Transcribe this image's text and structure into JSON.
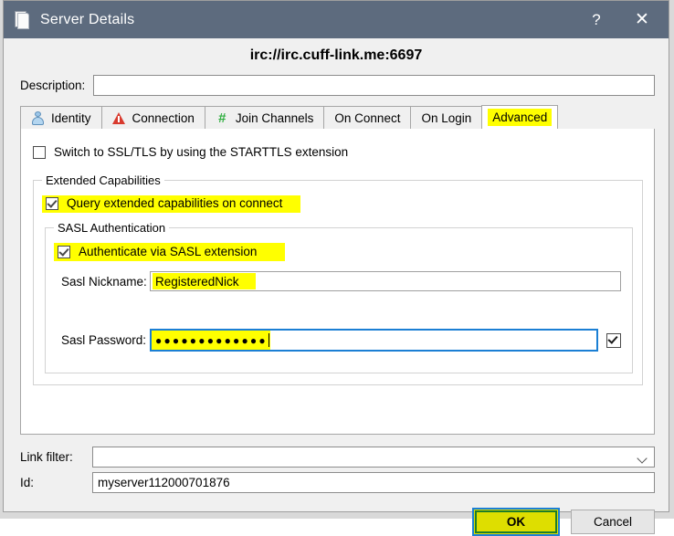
{
  "window": {
    "title": "Server Details",
    "icon": "page-icon",
    "help_label": "?",
    "close_label": "✕"
  },
  "header": {
    "server_url": "irc://irc.cuff-link.me:6697"
  },
  "description": {
    "label": "Description:",
    "value": "",
    "placeholder": ""
  },
  "tabs": [
    {
      "label": "Identity",
      "icon": "person-icon",
      "selected": false,
      "highlighted": false
    },
    {
      "label": "Connection",
      "icon": "warning-triangle-icon",
      "selected": false,
      "highlighted": false
    },
    {
      "label": "Join Channels",
      "icon": "hash-icon",
      "selected": false,
      "highlighted": false
    },
    {
      "label": "On Connect",
      "icon": "",
      "selected": false,
      "highlighted": false
    },
    {
      "label": "On Login",
      "icon": "",
      "selected": false,
      "highlighted": false
    },
    {
      "label": "Advanced",
      "icon": "",
      "selected": true,
      "highlighted": true
    }
  ],
  "advanced": {
    "starttls": {
      "label": "Switch to SSL/TLS by using the STARTTLS extension",
      "checked": false,
      "highlighted": false
    },
    "extended_capabilities": {
      "title": "Extended Capabilities",
      "query_on_connect": {
        "label": "Query extended capabilities on connect",
        "checked": true,
        "highlighted": true
      },
      "sasl": {
        "title": "SASL Authentication",
        "authenticate": {
          "label": "Authenticate via SASL extension",
          "checked": true,
          "highlighted": true
        },
        "nickname": {
          "label": "Sasl Nickname:",
          "value": "RegisteredNick",
          "highlighted": true
        },
        "password": {
          "label": "Sasl Password:",
          "value": "●●●●●●●●●●●●●",
          "highlighted": true,
          "focused": true,
          "reveal_checkbox_checked": true
        }
      }
    }
  },
  "link_filter": {
    "label": "Link filter:",
    "value": "",
    "icon": "chevron-down-icon"
  },
  "id_field": {
    "label": "Id:",
    "value": "myserver112000701876"
  },
  "buttons": {
    "ok": "OK",
    "cancel": "Cancel"
  },
  "colors": {
    "titlebar": "#5d6b7e",
    "highlight": "#ffff00",
    "focus_border": "#1b7fd4",
    "ok_border": "#1d7d28",
    "ok_fill": "#dede00"
  }
}
